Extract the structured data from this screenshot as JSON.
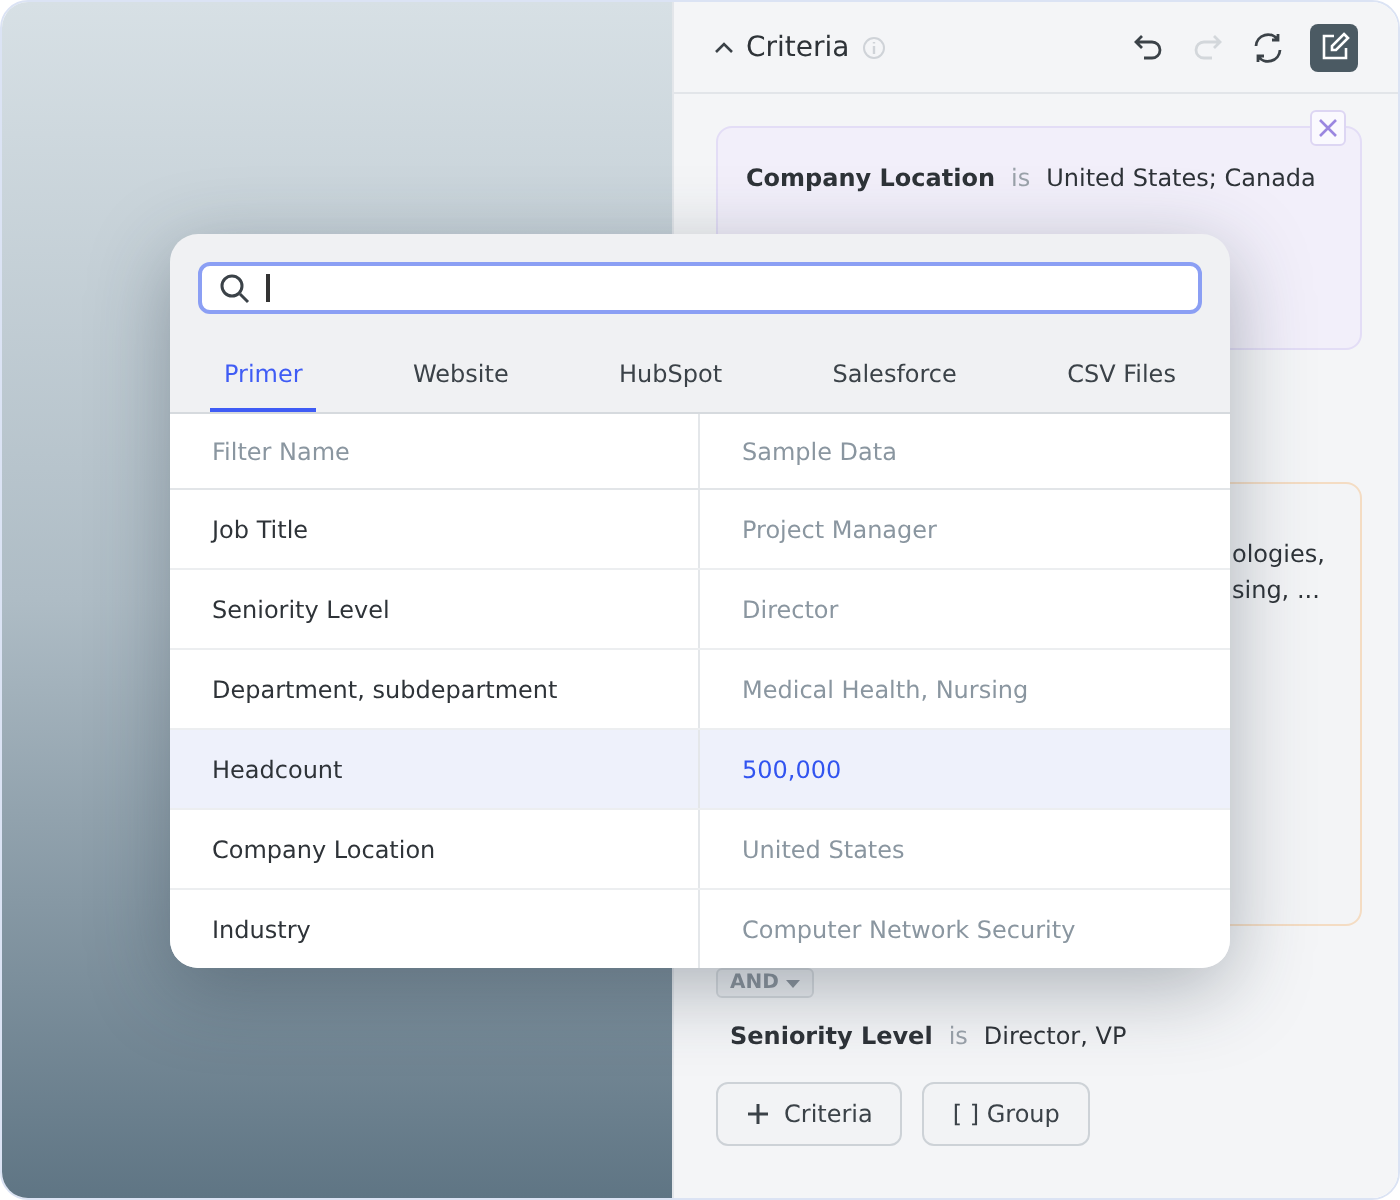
{
  "panel": {
    "title": "Criteria",
    "expanded": true,
    "undo_disabled": false,
    "redo_disabled": true
  },
  "criteria_card": {
    "field": "Company Location",
    "operator": "is",
    "value": "United States; Canada"
  },
  "partial_card": {
    "lines": [
      "ologies,",
      "sing, ..."
    ]
  },
  "joiner": {
    "label": "AND"
  },
  "criterion": {
    "field": "Seniority Level",
    "operator": "is",
    "value": "Director, VP"
  },
  "buttons": [
    {
      "kind": "add",
      "label": "Criteria"
    },
    {
      "kind": "group",
      "label": "[ ]"
    }
  ],
  "group_button_label": "Group",
  "popup": {
    "tabs": [
      {
        "label": "Primer",
        "selected": true
      },
      {
        "label": "Website",
        "selected": false
      },
      {
        "label": "HubSpot",
        "selected": false
      },
      {
        "label": "Salesforce",
        "selected": false
      },
      {
        "label": "CSV Files",
        "selected": false
      }
    ],
    "table": {
      "columns": [
        "Filter Name",
        "Sample Data"
      ],
      "rows": [
        {
          "name": "Job Title",
          "sample": "Project Manager",
          "selected": false
        },
        {
          "name": "Seniority Level",
          "sample": "Director",
          "selected": false
        },
        {
          "name": "Department, subdepartment",
          "sample": "Medical Health, Nursing",
          "selected": false
        },
        {
          "name": "Headcount",
          "sample": "500,000",
          "selected": true
        },
        {
          "name": "Company Location",
          "sample": "United States",
          "selected": false
        },
        {
          "name": "Industry",
          "sample": "Computer Network Security",
          "selected": false
        }
      ]
    }
  }
}
